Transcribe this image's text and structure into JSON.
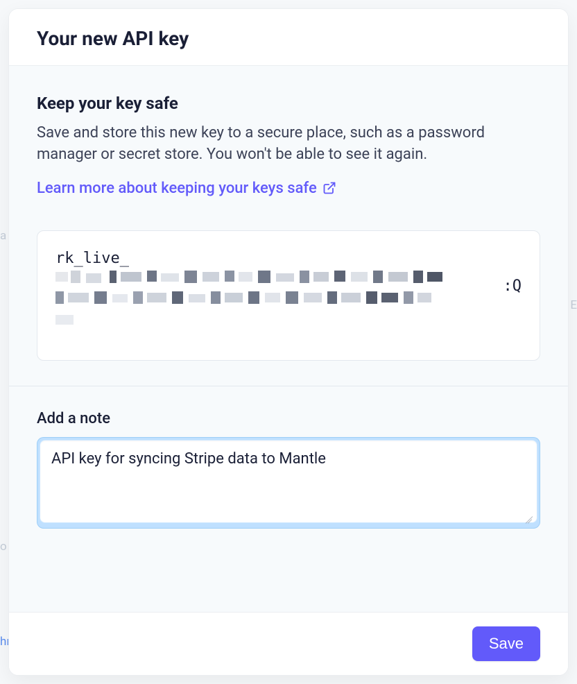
{
  "header": {
    "title": "Your new API key"
  },
  "keep_safe": {
    "heading": "Keep your key safe",
    "body": "Save and store this new key to a secure place, such as a password manager or secret store. You won't be able to see it again.",
    "learn_more_label": "Learn more about keeping your keys safe"
  },
  "api_key": {
    "visible_prefix": "rk_live_",
    "visible_suffix": ":Q"
  },
  "note": {
    "label": "Add a note",
    "value": "API key for syncing Stripe data to Mantle"
  },
  "footer": {
    "save_label": "Save"
  }
}
